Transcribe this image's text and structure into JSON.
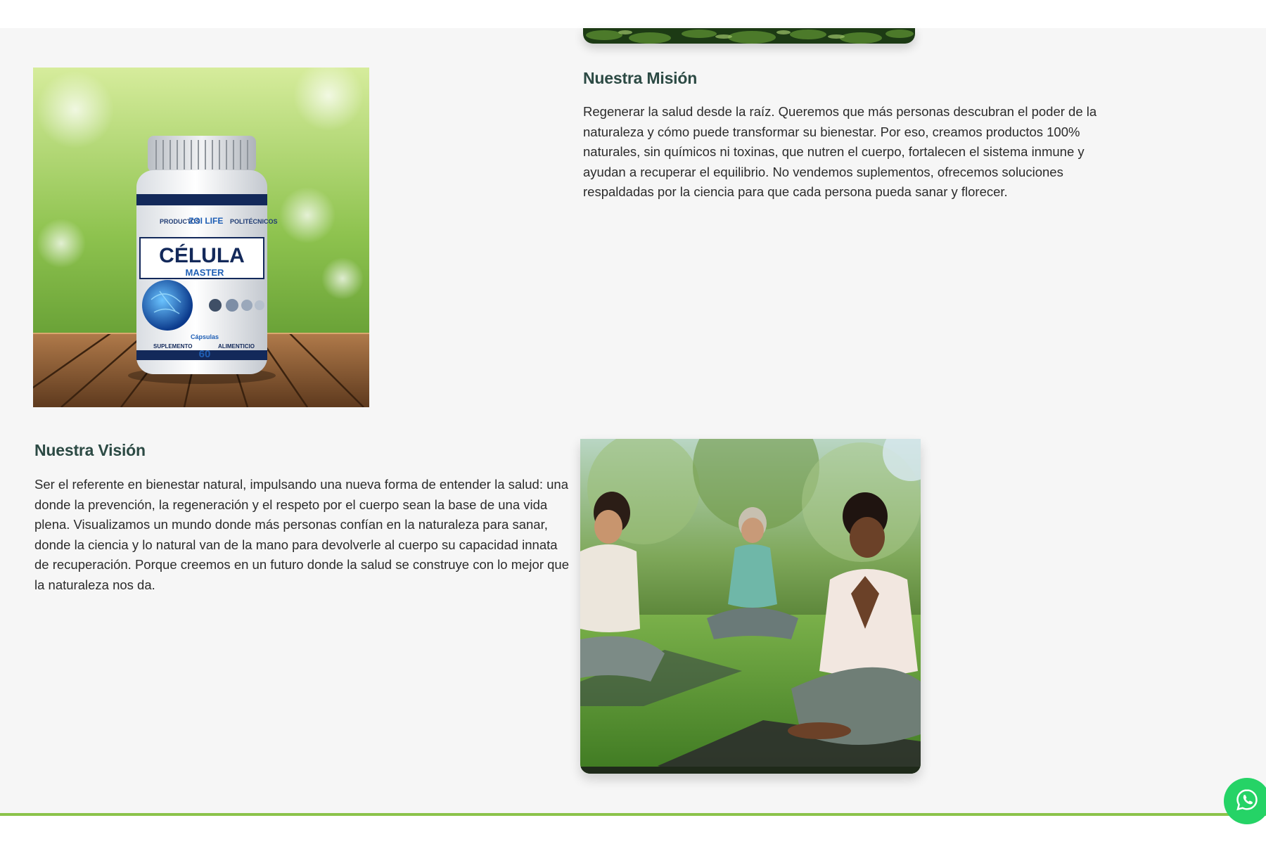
{
  "mission": {
    "title": "Nuestra Misión",
    "text": "Regenerar la salud desde la raíz. Queremos que más personas descubran el poder de la naturaleza y cómo puede transformar su bienestar. Por eso, creamos productos 100% naturales, sin químicos ni toxinas, que nutren el cuerpo, fortalecen el sistema inmune y ayudan a recuperar el equilibrio. No vendemos suplementos, ofrecemos soluciones respaldadas por la ciencia para que cada persona pueda sanar y florecer."
  },
  "vision": {
    "title": "Nuestra Visión",
    "text": "Ser el referente en bienestar natural, impulsando una nueva forma de entender la salud: una donde la prevención, la regeneración y el respeto por el cuerpo sean la base de una vida plena. Visualizamos un mundo donde más personas confían en la naturaleza para sanar, donde la ciencia y lo natural van de la mano para devolverle al cuerpo su capacidad innata de recuperación. Porque creemos en un futuro donde la salud se construye con lo mejor que la naturaleza nos da."
  },
  "product": {
    "brand_left": "PRODUCTOS",
    "brand_logo": "ZOI LIFE",
    "brand_right": "POLITÉCNICOS",
    "name": "CÉLULA",
    "subname": "MASTER",
    "footer_left": "SUPLEMENTO",
    "footer_right": "ALIMENTICIO",
    "capsule_word": "Cápsulas",
    "capsule_count": "60"
  },
  "colors": {
    "title": "#2c4a44",
    "accent_line": "#8bc34a",
    "whatsapp": "#25d366",
    "background": "#f6f6f6"
  },
  "icons": {
    "whatsapp": "whatsapp-icon"
  }
}
